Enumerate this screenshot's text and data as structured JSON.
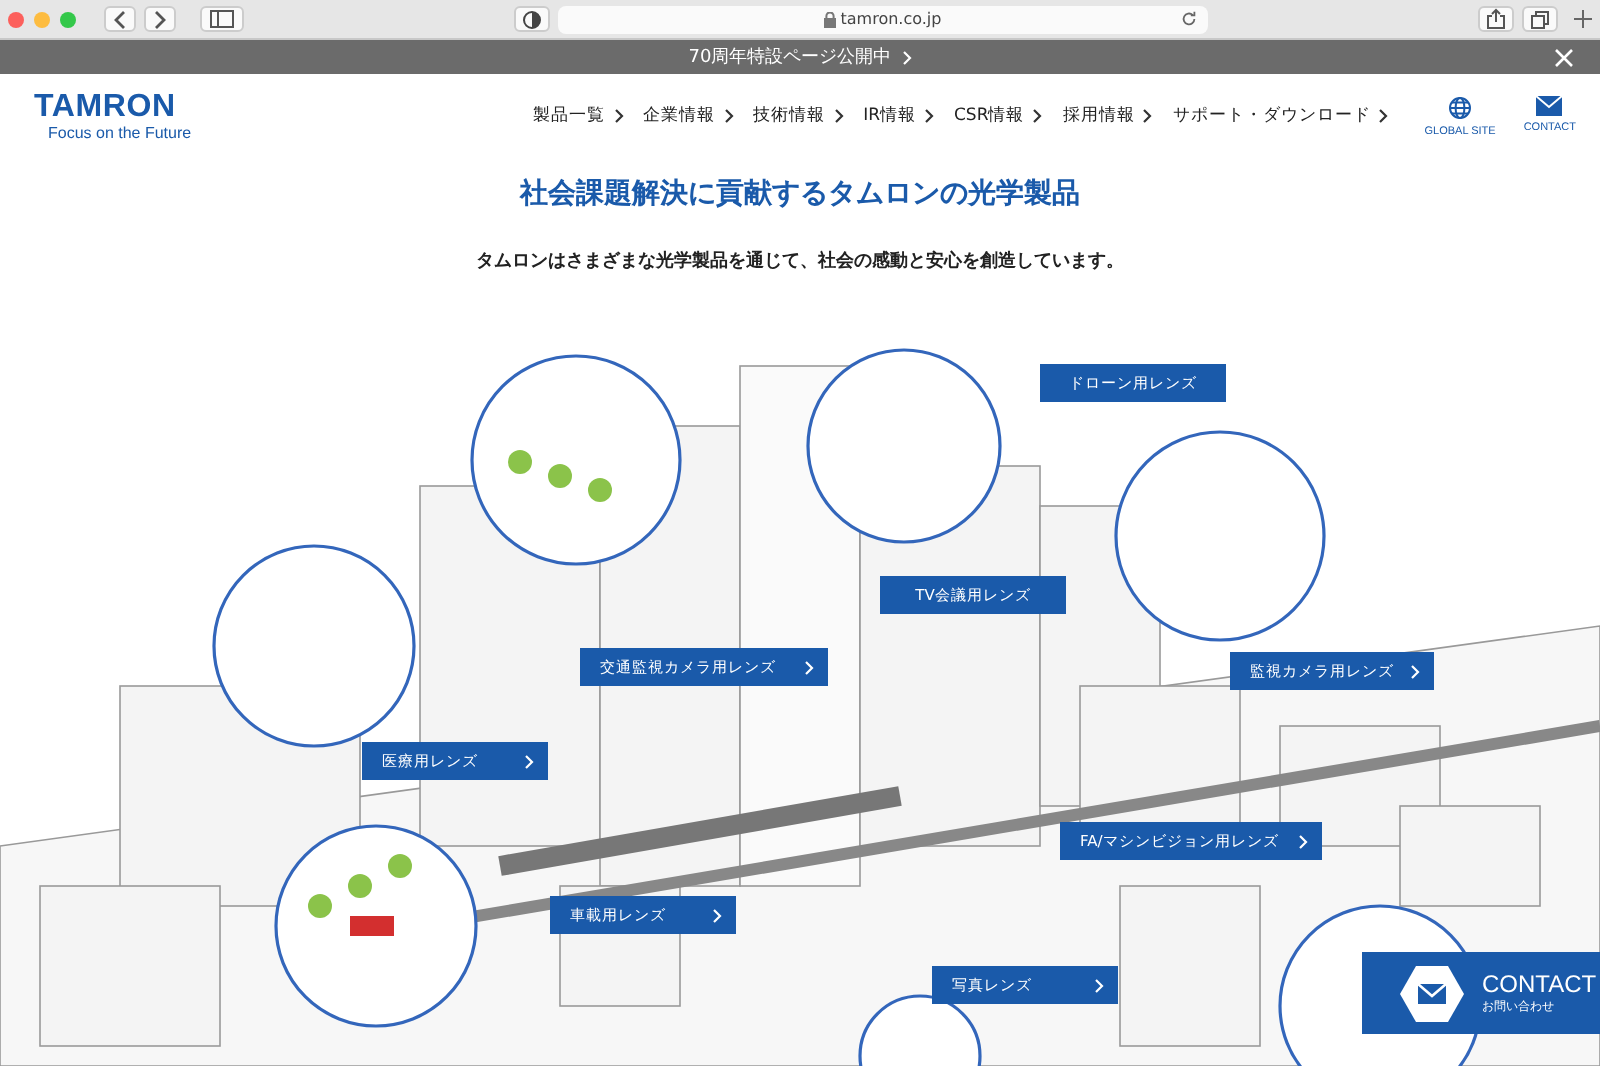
{
  "browser": {
    "url": "tamron.co.jp"
  },
  "banner": {
    "text": "70周年特設ページ公開中"
  },
  "header": {
    "logo": "TAMRON",
    "tagline": "Focus on the Future",
    "nav": [
      {
        "label": "製品一覧"
      },
      {
        "label": "企業情報"
      },
      {
        "label": "技術情報"
      },
      {
        "label": "IR情報"
      },
      {
        "label": "CSR情報"
      },
      {
        "label": "採用情報"
      },
      {
        "label": "サポート・ダウンロード"
      }
    ],
    "links": [
      {
        "kind": "globe",
        "label": "GLOBAL SITE"
      },
      {
        "kind": "mail",
        "label": "CONTACT"
      }
    ]
  },
  "heading": "社会課題解決に貢献するタムロンの光学製品",
  "lead": "タムロンはさまざまな光学製品を通じて、社会の感動と安心を創造しています。",
  "labels": [
    {
      "text": "ドローン用レンズ",
      "arrow": false
    },
    {
      "text": "TV会議用レンズ",
      "arrow": false
    },
    {
      "text": "交通監視カメラ用レンズ",
      "arrow": true
    },
    {
      "text": "監視カメラ用レンズ",
      "arrow": true
    },
    {
      "text": "医療用レンズ",
      "arrow": true
    },
    {
      "text": "FA/マシンビジョン用レンズ",
      "arrow": true
    },
    {
      "text": "車載用レンズ",
      "arrow": true
    },
    {
      "text": "写真レンズ",
      "arrow": true
    }
  ],
  "contact": {
    "title": "CONTACT",
    "subtitle": "お問い合わせ"
  }
}
